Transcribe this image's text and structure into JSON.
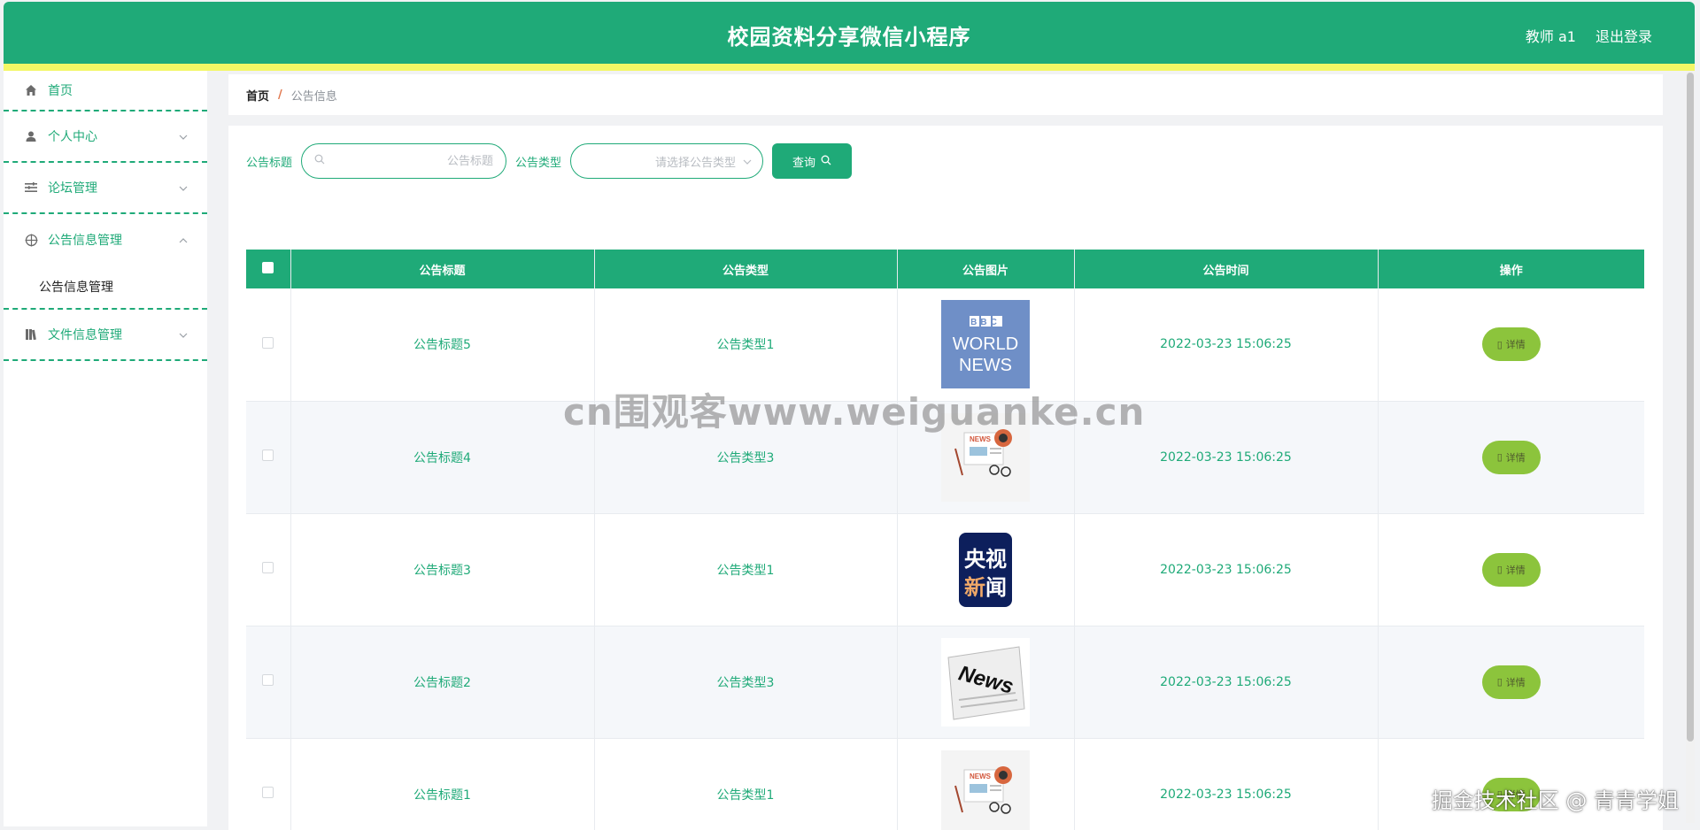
{
  "header": {
    "title": "校园资料分享微信小程序",
    "user": "教师 a1",
    "logout": "退出登录"
  },
  "sidebar": {
    "items": [
      {
        "label": "首页",
        "icon": "home-icon"
      },
      {
        "label": "个人中心",
        "icon": "user-icon"
      },
      {
        "label": "论坛管理",
        "icon": "list-icon"
      },
      {
        "label": "公告信息管理",
        "icon": "compass-icon",
        "expanded": true,
        "children": [
          {
            "label": "公告信息管理"
          }
        ]
      },
      {
        "label": "文件信息管理",
        "icon": "book-icon"
      }
    ]
  },
  "breadcrumb": {
    "home": "首页",
    "separator": "/",
    "current": "公告信息"
  },
  "search": {
    "title_label": "公告标题",
    "title_placeholder": "公告标题",
    "type_label": "公告类型",
    "type_placeholder": "请选择公告类型",
    "query_button": "查询"
  },
  "table": {
    "headers": [
      "公告标题",
      "公告类型",
      "公告图片",
      "公告时间",
      "操作"
    ],
    "rows": [
      {
        "title": "公告标题5",
        "type": "公告类型1",
        "image": "bbc-world-news",
        "time": "2022-03-23 15:06:25",
        "action": "详情"
      },
      {
        "title": "公告标题4",
        "type": "公告类型3",
        "image": "news-paper-clip",
        "time": "2022-03-23 15:06:25",
        "action": "详情"
      },
      {
        "title": "公告标题3",
        "type": "公告类型1",
        "image": "cctv-news",
        "time": "2022-03-23 15:06:25",
        "action": "详情"
      },
      {
        "title": "公告标题2",
        "type": "公告类型3",
        "image": "newspaper",
        "time": "2022-03-23 15:06:25",
        "action": "详情"
      },
      {
        "title": "公告标题1",
        "type": "公告类型1",
        "image": "news-paper-clip",
        "time": "2022-03-23 15:06:25",
        "action": "详情"
      }
    ]
  },
  "images": {
    "bbc_line1": "BBC",
    "bbc_line2": "WORLD",
    "bbc_line3": "NEWS",
    "news_word": "NEWS",
    "cctv_line1": "央视",
    "cctv_line2a": "新",
    "cctv_line2b": "闻",
    "newspaper_word": "News"
  },
  "watermarks": {
    "center": "cn围观客www.weiguanke.cn",
    "bottom_right": "掘金技术社区 @ 青青学姐"
  },
  "colors": {
    "primary": "#1faa78",
    "accent_strip": "#f3f765",
    "detail_button": "#8cc43c"
  }
}
